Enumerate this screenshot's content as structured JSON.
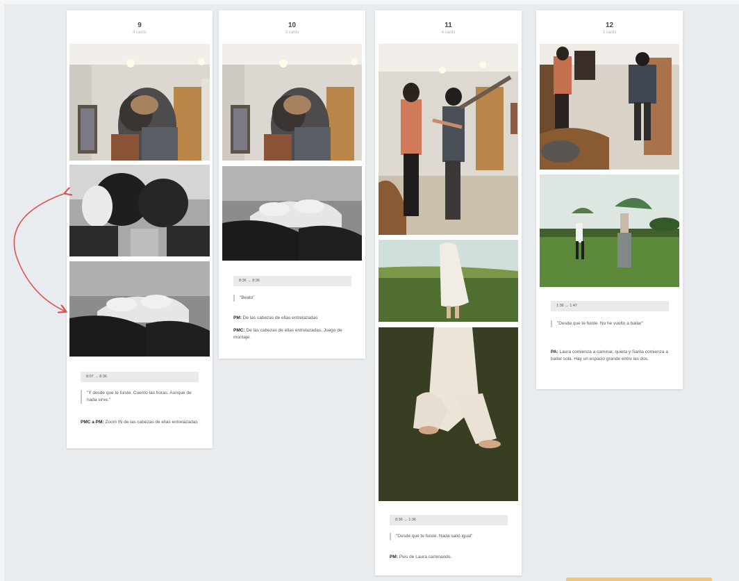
{
  "cards": [
    {
      "number": "9",
      "subtitle": "4 cards",
      "timecode": "8:07  →  8:36",
      "quote": "\"Y desde que te fuiste. Cuento las horas. Aunque de nada sirve.\"",
      "note_prefix": "PMC a PM:",
      "note_text": " Zoom IN de las cabezas de ellas entrelazadas"
    },
    {
      "number": "10",
      "subtitle": "3 cards",
      "timecode": "8:36  →  8:36",
      "quote": "\"Beato\"",
      "note1_prefix": "PM:",
      "note1_text": " De las cabezas de ellas entrelazadas",
      "note2_prefix": "PMC:",
      "note2_text": " De las cabezas de ellas entrelazadas. Juego de montaje."
    },
    {
      "number": "11",
      "subtitle": "4 cards",
      "timecode": "8:36  →  1:36",
      "quote": "\"Desde que te fuiste. Nada salió igual\"",
      "note_prefix": "PM:",
      "note_text": " Pies de Laura caminando."
    },
    {
      "number": "12",
      "subtitle": "3 cards",
      "timecode": "1:36  →  1:47",
      "quote": "\"Desde que te fuiste. No he vuelto a bailar\"",
      "note_prefix": "PA:",
      "note_text": " Laura comienza a caminar, quieta y Sarita comienza a bailar sola. Hay un espacio grande entre las dos."
    }
  ],
  "colors": {
    "background": "#e9ecef",
    "card": "#ffffff",
    "arrow": "#e0524e",
    "timecode_bg": "#eaeaea"
  }
}
